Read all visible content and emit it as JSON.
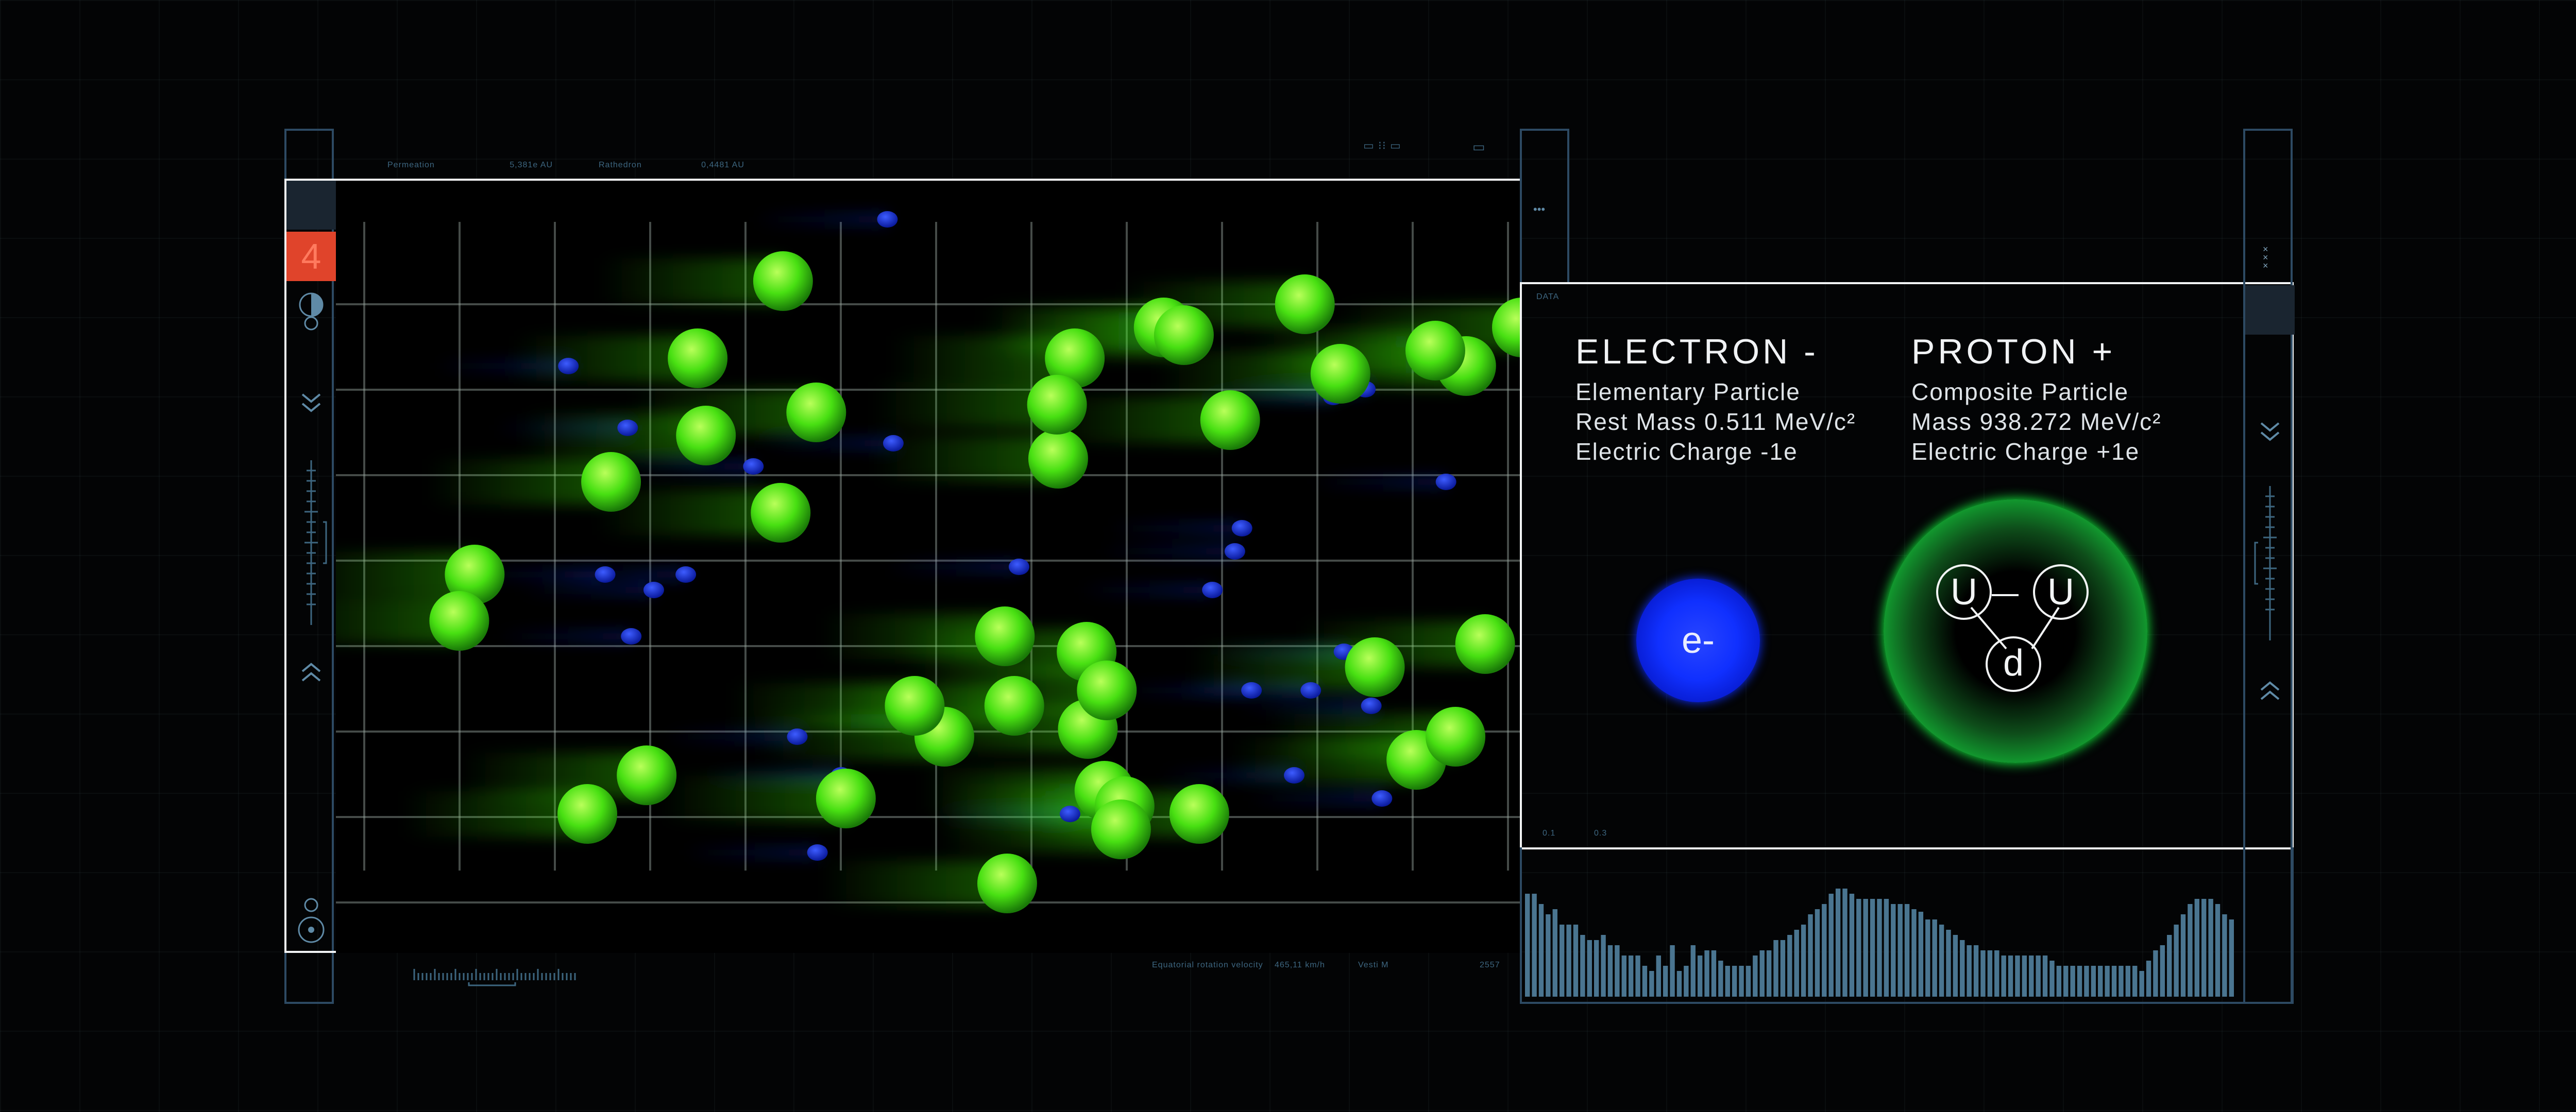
{
  "header": {
    "items": [
      {
        "label": "Permeation",
        "value": "5,381e AU"
      },
      {
        "label": "Rathedron",
        "value": "0,4481 AU"
      }
    ],
    "right_codes": [
      "▭ ⁝⁝ ▭",
      "▭"
    ]
  },
  "left_rail": {
    "badge_number": "4"
  },
  "viz": {
    "particles_green": [
      [
        0.117,
        0.51
      ],
      [
        0.104,
        0.57
      ],
      [
        0.232,
        0.39
      ],
      [
        0.305,
        0.23
      ],
      [
        0.312,
        0.33
      ],
      [
        0.377,
        0.13
      ],
      [
        0.405,
        0.3
      ],
      [
        0.262,
        0.77
      ],
      [
        0.43,
        0.8
      ],
      [
        0.513,
        0.72
      ],
      [
        0.564,
        0.59
      ],
      [
        0.609,
        0.36
      ],
      [
        0.633,
        0.61
      ],
      [
        0.572,
        0.68
      ],
      [
        0.634,
        0.71
      ],
      [
        0.65,
        0.66
      ],
      [
        0.648,
        0.79
      ],
      [
        0.665,
        0.81
      ],
      [
        0.662,
        0.84
      ],
      [
        0.728,
        0.82
      ],
      [
        0.754,
        0.31
      ],
      [
        0.817,
        0.16
      ],
      [
        0.847,
        0.25
      ],
      [
        0.911,
        0.75
      ],
      [
        0.969,
        0.6
      ],
      [
        0.944,
        0.72
      ],
      [
        1.0,
        0.19
      ],
      [
        0.953,
        0.24
      ],
      [
        0.927,
        0.22
      ],
      [
        0.876,
        0.63
      ],
      [
        0.623,
        0.23
      ],
      [
        0.608,
        0.29
      ],
      [
        0.698,
        0.19
      ],
      [
        0.715,
        0.2
      ],
      [
        0.488,
        0.68
      ],
      [
        0.566,
        0.91
      ],
      [
        0.212,
        0.82
      ],
      [
        0.375,
        0.43
      ]
    ],
    "particles_blue": [
      [
        0.465,
        0.05
      ],
      [
        0.196,
        0.24
      ],
      [
        0.246,
        0.32
      ],
      [
        0.352,
        0.37
      ],
      [
        0.47,
        0.34
      ],
      [
        0.576,
        0.5
      ],
      [
        0.227,
        0.51
      ],
      [
        0.268,
        0.53
      ],
      [
        0.249,
        0.59
      ],
      [
        0.295,
        0.51
      ],
      [
        0.426,
        0.77
      ],
      [
        0.389,
        0.72
      ],
      [
        0.406,
        0.87
      ],
      [
        0.619,
        0.82
      ],
      [
        0.739,
        0.53
      ],
      [
        0.772,
        0.66
      ],
      [
        0.808,
        0.77
      ],
      [
        0.822,
        0.66
      ],
      [
        0.85,
        0.61
      ],
      [
        0.873,
        0.68
      ],
      [
        0.882,
        0.8
      ],
      [
        0.936,
        0.39
      ],
      [
        0.841,
        0.28
      ],
      [
        0.868,
        0.27
      ],
      [
        0.764,
        0.45
      ],
      [
        0.758,
        0.48
      ]
    ]
  },
  "bottom_readout": {
    "label": "Equatorial rotation velocity",
    "value": "465,11 km/h",
    "extra": "Vesti M",
    "code": "2557"
  },
  "panel": {
    "tag": "DATA",
    "top_dots": "•••",
    "scale_marks": [
      "0.1",
      "0.3"
    ],
    "electron": {
      "title": "ELECTRON -",
      "line1": "Elementary Particle",
      "line2": "Rest Mass 0.511 MeV/c²",
      "line3": "Electric Charge -1e",
      "symbol": "e-"
    },
    "proton": {
      "title": "PROTON +",
      "line1": "Composite Particle",
      "line2": "Mass 938.272 MeV/c²",
      "line3": "Electric Charge +1e",
      "quarks": [
        "U",
        "U",
        "d"
      ]
    }
  },
  "histogram": {
    "values": [
      40,
      40,
      36,
      32,
      34,
      28,
      28,
      28,
      24,
      22,
      22,
      24,
      20,
      20,
      16,
      16,
      16,
      12,
      10,
      16,
      12,
      20,
      10,
      12,
      20,
      16,
      18,
      18,
      14,
      12,
      12,
      12,
      12,
      16,
      18,
      18,
      22,
      22,
      24,
      26,
      28,
      32,
      34,
      36,
      40,
      42,
      42,
      40,
      38,
      38,
      38,
      38,
      38,
      36,
      36,
      36,
      34,
      33,
      30,
      30,
      28,
      26,
      24,
      22,
      20,
      20,
      18,
      18,
      18,
      16,
      16,
      16,
      16,
      16,
      16,
      16,
      14,
      12,
      12,
      12,
      12,
      12,
      12,
      12,
      12,
      12,
      12,
      12,
      12,
      10,
      14,
      18,
      20,
      24,
      28,
      32,
      36,
      38,
      38,
      38,
      36,
      32,
      30
    ],
    "color": "#4a7590"
  },
  "colors": {
    "accent_red": "#e0442b",
    "electron_blue": "#1030ff",
    "proton_green": "#14ff40",
    "particle_green": "#5cff1a",
    "particle_blue": "#1432e8"
  }
}
